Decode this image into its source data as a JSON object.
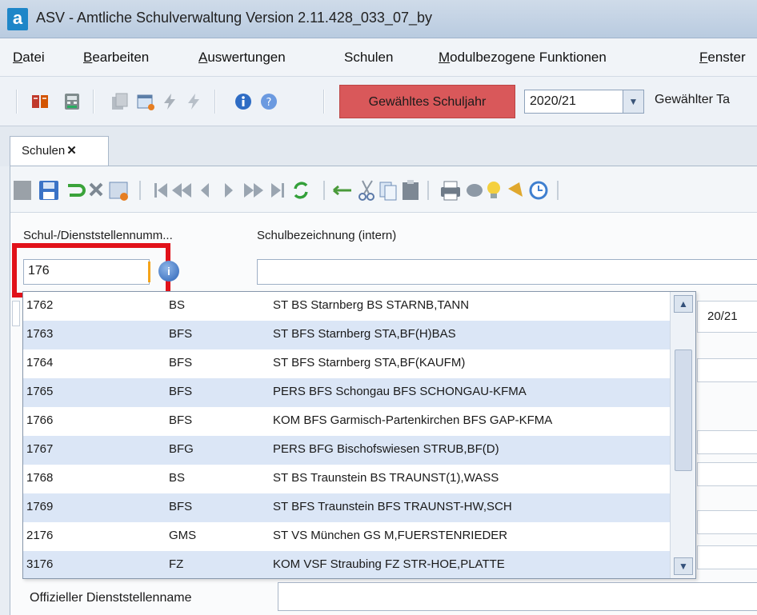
{
  "window": {
    "logo": "a",
    "title": "ASV - Amtliche Schulverwaltung Version 2.11.428_033_07_by"
  },
  "menu": [
    {
      "first": "D",
      "rest": "atei"
    },
    {
      "first": "B",
      "rest": "earbeiten"
    },
    {
      "first": "A",
      "rest": "uswertungen"
    },
    {
      "first": "",
      "rest": "Schulen"
    },
    {
      "first": "M",
      "rest": "odulbezogene Funktionen"
    },
    {
      "first": "F",
      "rest": "enster"
    }
  ],
  "toolbar": {
    "year_button": "Gewähltes Schuljahr",
    "year_value": "2020/21",
    "day_label": "Gewählter Ta",
    "colors": {
      "year_button": "#d9585a"
    }
  },
  "tab": {
    "label": "Schulen",
    "close": "✕"
  },
  "form": {
    "number_label": "Schul-/Dienststellennumm...",
    "name_label": "Schulbezeichnung (intern)",
    "number_value": "176",
    "year_fragment": "20/21",
    "official_name_label": "Offizieller Dienststellenname"
  },
  "dropdown": {
    "rows": [
      {
        "nr": "1762",
        "type": "BS",
        "name": "ST BS Starnberg BS STARNB,TANN"
      },
      {
        "nr": "1763",
        "type": "BFS",
        "name": "ST BFS Starnberg STA,BF(H)BAS"
      },
      {
        "nr": "1764",
        "type": "BFS",
        "name": "ST BFS Starnberg STA,BF(KAUFM)"
      },
      {
        "nr": "1765",
        "type": "BFS",
        "name": "PERS BFS Schongau BFS SCHONGAU-KFMA"
      },
      {
        "nr": "1766",
        "type": "BFS",
        "name": "KOM BFS Garmisch-Partenkirchen BFS GAP-KFMA"
      },
      {
        "nr": "1767",
        "type": "BFG",
        "name": "PERS BFG Bischofswiesen STRUB,BF(D)"
      },
      {
        "nr": "1768",
        "type": "BS",
        "name": "ST BS Traunstein BS TRAUNST(1),WASS"
      },
      {
        "nr": "1769",
        "type": "BFS",
        "name": "ST BFS Traunstein BFS TRAUNST-HW,SCH"
      },
      {
        "nr": "2176",
        "type": "GMS",
        "name": "ST VS München GS M,FUERSTENRIEDER"
      },
      {
        "nr": "3176",
        "type": "FZ",
        "name": "KOM VSF Straubing FZ STR-HOE,PLATTE"
      }
    ],
    "colors": {
      "alt_row": "#dbe6f6"
    }
  },
  "annotation": {
    "color": "#e1121a"
  }
}
